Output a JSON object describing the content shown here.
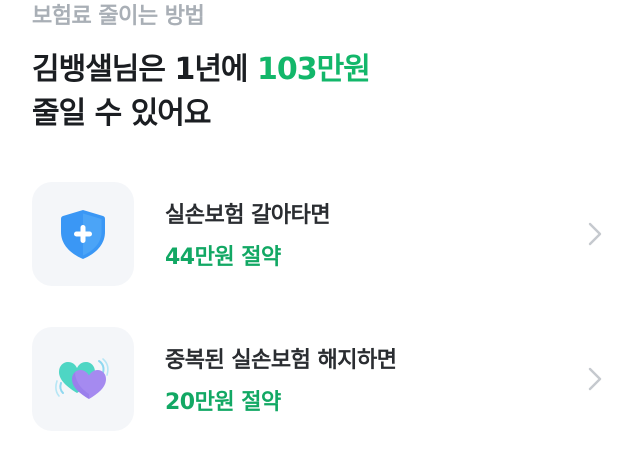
{
  "section_label": "보험료 줄이는 방법",
  "headline": {
    "line1_prefix": "김뱅샐님은 1년에 ",
    "line1_amount": "103만원",
    "line2": "줄일 수 있어요"
  },
  "options": [
    {
      "icon": "shield-plus-icon",
      "title": "실손보험 갈아타면",
      "saving": "44만원 절약"
    },
    {
      "icon": "two-hearts-icon",
      "title": "중복된 실손보험 해지하면",
      "saving": "20만원 절약"
    }
  ],
  "colors": {
    "accent_green": "#12B76A",
    "label_gray": "#A9AFB6",
    "shield_blue": "#3A97F5",
    "heart_teal": "#4ED6C4",
    "heart_purple": "#A58AF0"
  }
}
